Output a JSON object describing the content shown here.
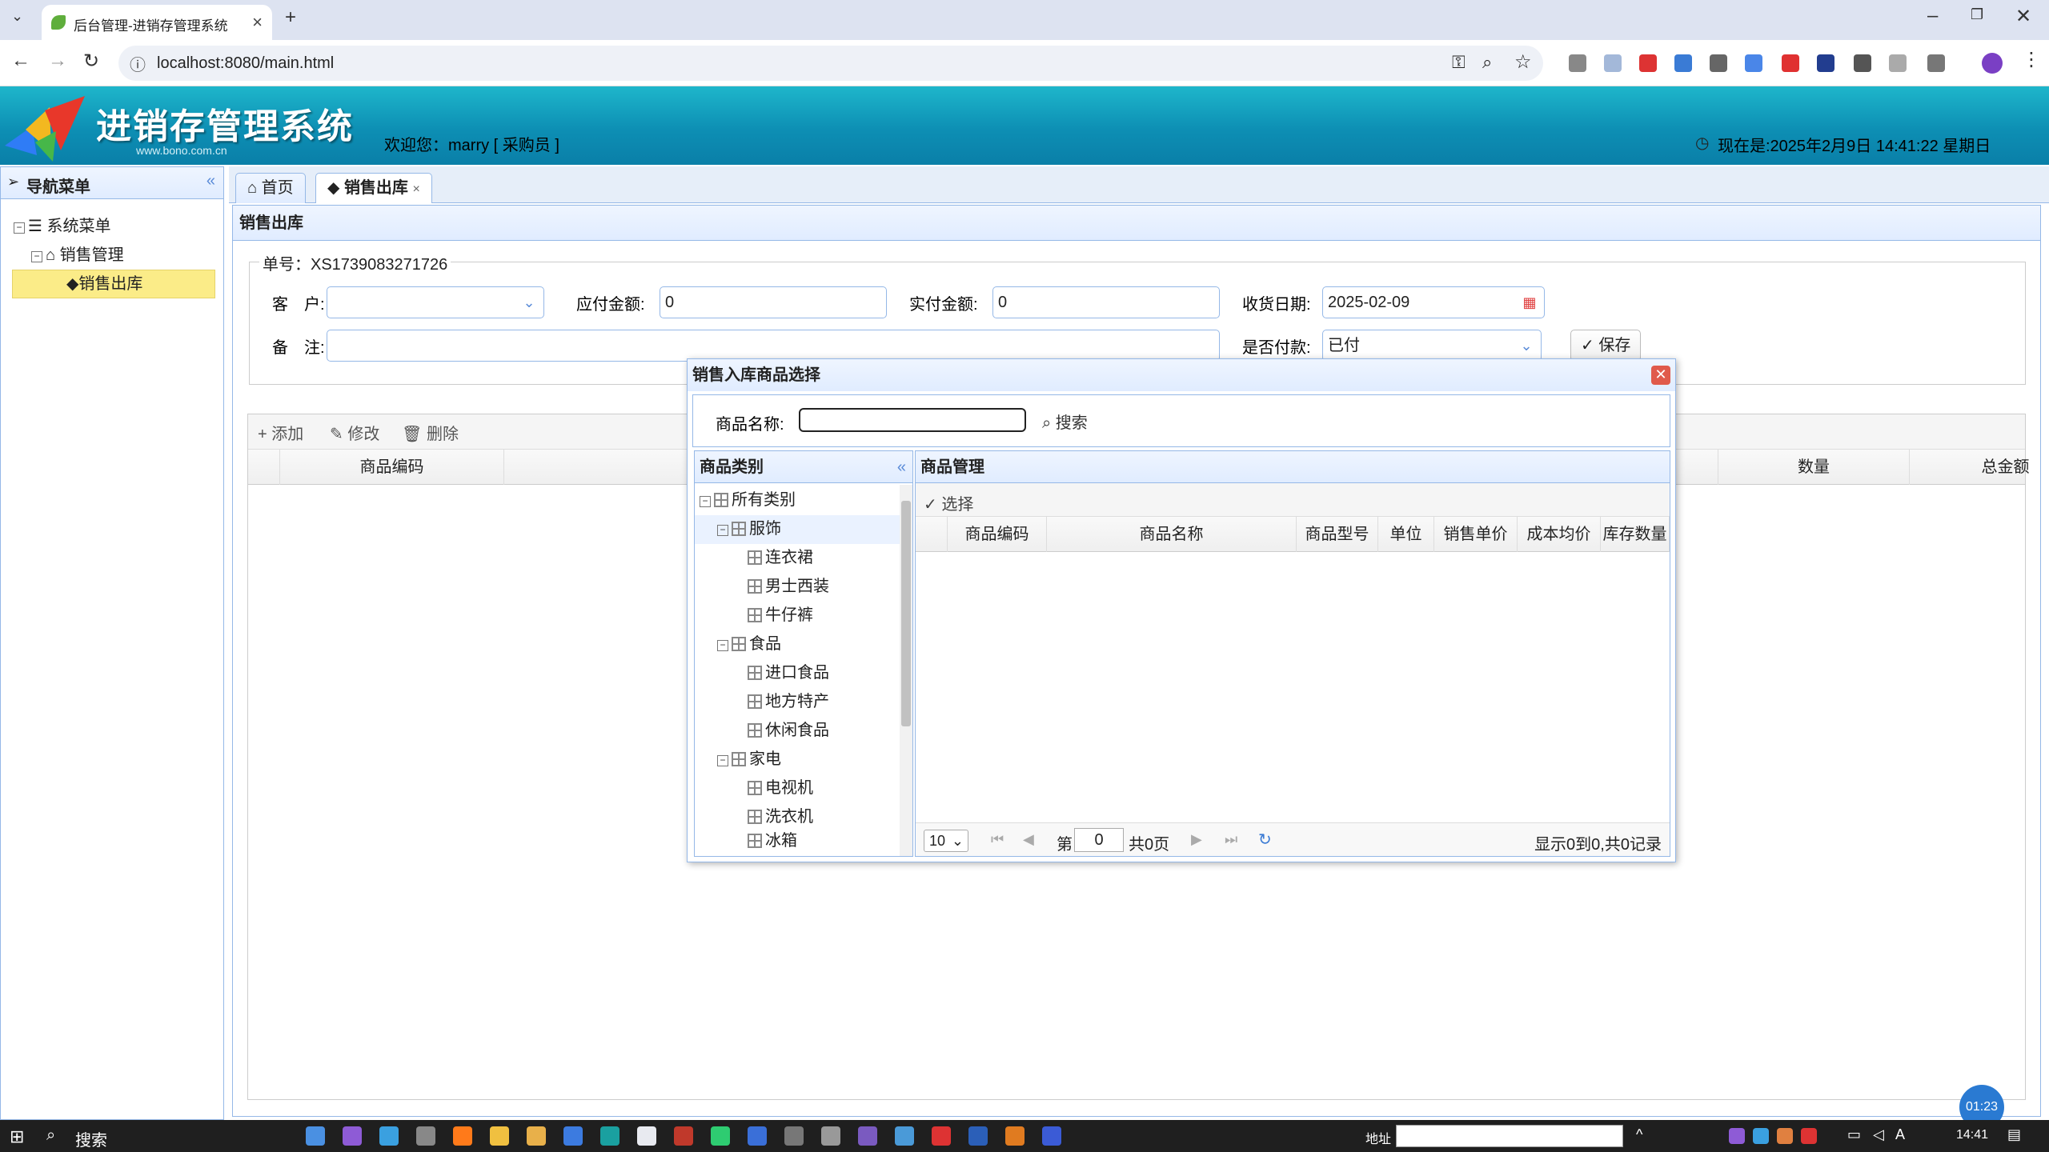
{
  "browser": {
    "tab_title": "后台管理-进销存管理系统",
    "url": "localhost:8080/main.html"
  },
  "header": {
    "system_name": "进销存管理系统",
    "logo_url_text": "www.bono.com.cn",
    "welcome": "欢迎您：marry [ 采购员 ]",
    "clock": "现在是:2025年2月9日 14:41:22 星期日"
  },
  "nav": {
    "title": "导航菜单",
    "items": [
      {
        "label": "系统菜单"
      },
      {
        "label": "销售管理"
      },
      {
        "label": "销售出库"
      }
    ]
  },
  "tabs": [
    {
      "label": "首页"
    },
    {
      "label": "销售出库"
    }
  ],
  "panel": {
    "title": "销售出库",
    "order_no": "单号：XS1739083271726",
    "customer_label": "客　户:",
    "customer_value": "",
    "payable_label": "应付金额:",
    "payable_value": "0",
    "paid_label": "实付金额:",
    "paid_value": "0",
    "date_label": "收货日期:",
    "date_value": "2025-02-09",
    "remark_label": "备　注:",
    "remark_value": "",
    "paid_status_label": "是否付款:",
    "paid_status_value": "已付",
    "save_label": "保存"
  },
  "table": {
    "add_label": "添加",
    "edit_label": "修改",
    "delete_label": "删除",
    "columns": [
      "商品编码",
      "数量",
      "总金额"
    ]
  },
  "dialog": {
    "title": "销售入库商品选择",
    "search_label": "商品名称:",
    "search_value": "",
    "search_button": "搜索",
    "category_title": "商品类别",
    "categories": [
      {
        "label": "所有类别"
      },
      {
        "label": "服饰"
      },
      {
        "label": "连衣裙"
      },
      {
        "label": "男士西装"
      },
      {
        "label": "牛仔裤"
      },
      {
        "label": "食品"
      },
      {
        "label": "进口食品"
      },
      {
        "label": "地方特产"
      },
      {
        "label": "休闲食品"
      },
      {
        "label": "家电"
      },
      {
        "label": "电视机"
      },
      {
        "label": "洗衣机"
      },
      {
        "label": "冰箱"
      }
    ],
    "product_title": "商品管理",
    "select_label": "选择",
    "columns": [
      "商品编码",
      "商品名称",
      "商品型号",
      "单位",
      "销售单价",
      "成本均价",
      "库存数量"
    ],
    "page_size": "10",
    "page_prefix": "第",
    "page_value": "0",
    "page_total": "共0页",
    "record_info": "显示0到0,共0记录"
  },
  "taskbar": {
    "search": "搜索",
    "address_label": "地址",
    "time": "14:41",
    "timer": "01:23"
  }
}
